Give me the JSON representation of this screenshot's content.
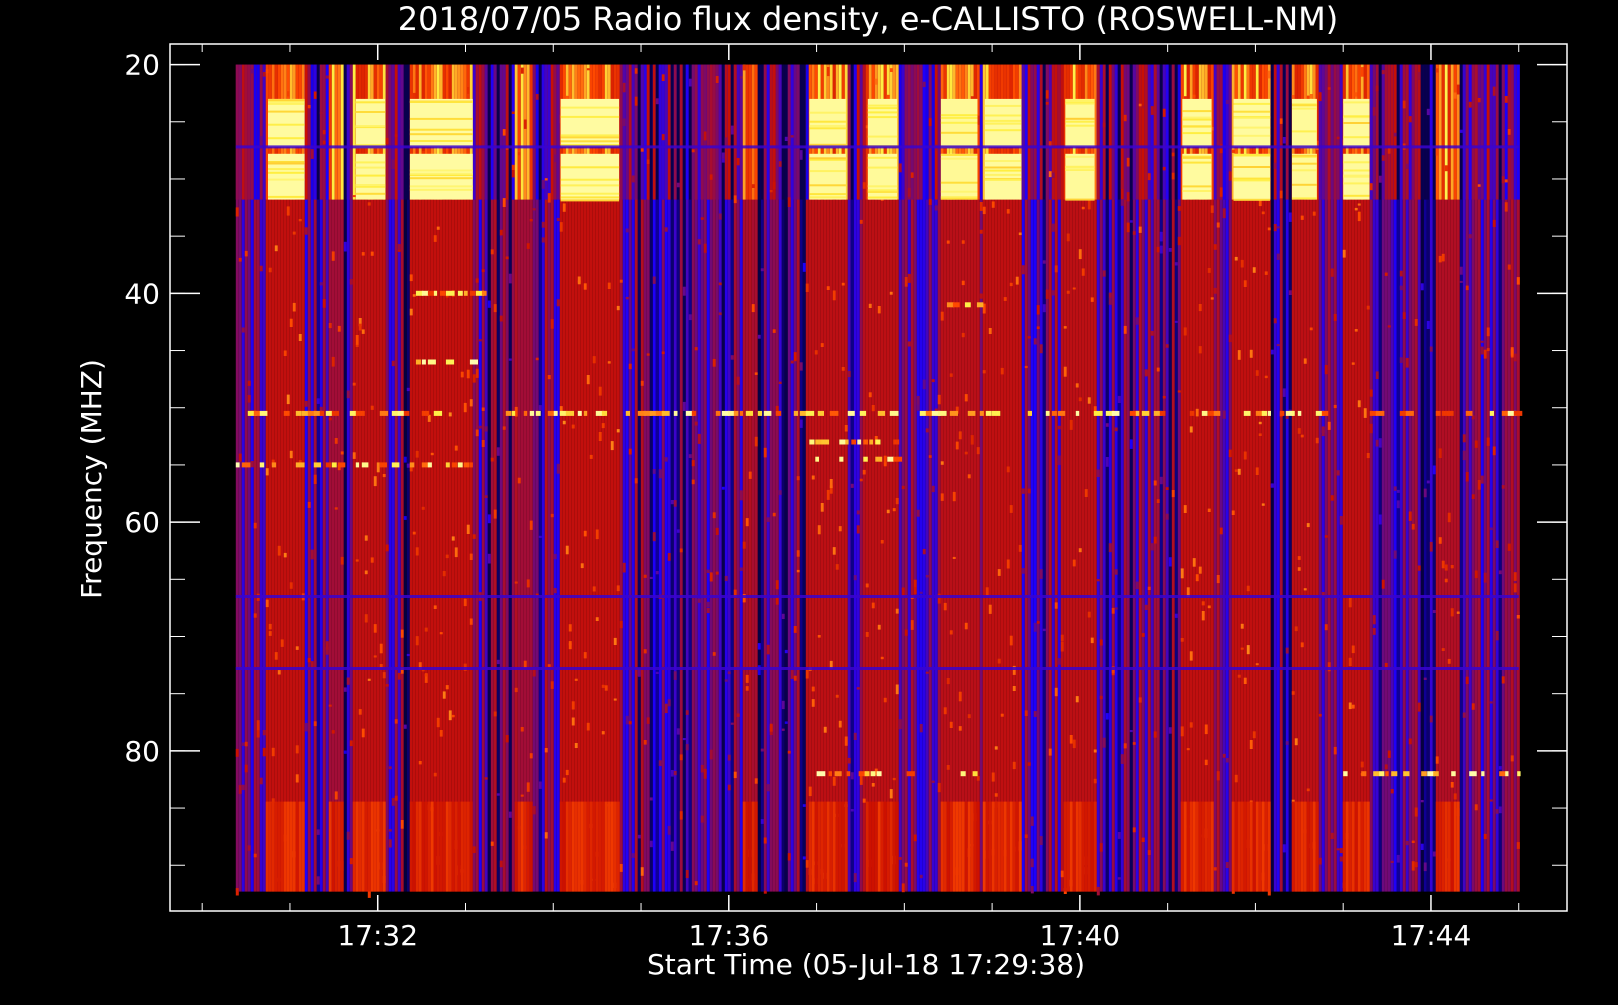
{
  "chart_data": {
    "type": "heatmap",
    "title": "2018/07/05  Radio flux density, e-CALLISTO (ROSWELL-NM)",
    "xlabel": "Start Time (05-Jul-18 17:29:38)",
    "ylabel": "Frequency (MHZ)",
    "x_ticks": [
      {
        "value": "17:32:00",
        "label": "17:32"
      },
      {
        "value": "17:36:00",
        "label": "17:36"
      },
      {
        "value": "17:40:00",
        "label": "17:40"
      },
      {
        "value": "17:44:00",
        "label": "17:44"
      }
    ],
    "y_ticks": [
      {
        "value": 20,
        "label": "20"
      },
      {
        "value": 40,
        "label": "40"
      },
      {
        "value": 60,
        "label": "60"
      },
      {
        "value": 80,
        "label": "80"
      }
    ],
    "x_range": [
      "17:29:38",
      "17:45:33"
    ],
    "y_range": [
      18.2,
      94
    ],
    "data_time_range": [
      "17:30:23",
      "17:45:00"
    ],
    "data_freq_range": [
      20,
      92.3
    ],
    "colormap": [
      "#000000",
      "#1a00ff",
      "#7a0a6a",
      "#cc1000",
      "#ff4a00",
      "#ffee40",
      "#ffffc0"
    ],
    "yellow_band_freqs": [
      [
        23,
        27.2
      ],
      [
        27.8,
        31.8
      ]
    ],
    "bright_columns": [
      {
        "start": "17:30:45",
        "end": "17:31:10",
        "intensity": 0.98
      },
      {
        "start": "17:31:28",
        "end": "17:31:35",
        "intensity": 0.45
      },
      {
        "start": "17:31:45",
        "end": "17:32:05",
        "intensity": 0.95
      },
      {
        "start": "17:32:22",
        "end": "17:33:05",
        "intensity": 0.99
      },
      {
        "start": "17:33:35",
        "end": "17:33:45",
        "intensity": 0.45
      },
      {
        "start": "17:34:05",
        "end": "17:34:45",
        "intensity": 0.99
      },
      {
        "start": "17:36:10",
        "end": "17:36:18",
        "intensity": 0.55
      },
      {
        "start": "17:36:55",
        "end": "17:37:20",
        "intensity": 0.9
      },
      {
        "start": "17:37:35",
        "end": "17:37:55",
        "intensity": 0.9
      },
      {
        "start": "17:38:25",
        "end": "17:38:50",
        "intensity": 0.85
      },
      {
        "start": "17:38:55",
        "end": "17:39:20",
        "intensity": 0.95
      },
      {
        "start": "17:39:50",
        "end": "17:40:10",
        "intensity": 0.9
      },
      {
        "start": "17:41:10",
        "end": "17:41:30",
        "intensity": 0.97
      },
      {
        "start": "17:41:45",
        "end": "17:42:10",
        "intensity": 0.97
      },
      {
        "start": "17:42:25",
        "end": "17:42:42",
        "intensity": 0.9
      },
      {
        "start": "17:43:00",
        "end": "17:43:18",
        "intensity": 0.95
      },
      {
        "start": "17:44:05",
        "end": "17:44:18",
        "intensity": 0.7
      }
    ],
    "hot_lines": [
      {
        "freq": 50.5,
        "start": "17:30:23",
        "end": "17:45:00"
      },
      {
        "freq": 55,
        "start": "17:30:23",
        "end": "17:33:05"
      },
      {
        "freq": 54.5,
        "start": "17:36:55",
        "end": "17:37:55"
      },
      {
        "freq": 46,
        "start": "17:32:22",
        "end": "17:33:05"
      },
      {
        "freq": 40,
        "start": "17:32:22",
        "end": "17:33:20"
      },
      {
        "freq": 41,
        "start": "17:38:25",
        "end": "17:38:55"
      },
      {
        "freq": 53,
        "start": "17:36:55",
        "end": "17:37:55"
      },
      {
        "freq": 82,
        "start": "17:37:00",
        "end": "17:38:55"
      },
      {
        "freq": 82,
        "start": "17:43:00",
        "end": "17:45:00"
      }
    ],
    "rfi_lines": [
      {
        "freq": 27.2
      },
      {
        "freq": 72.8
      },
      {
        "freq": 66.5
      }
    ]
  }
}
